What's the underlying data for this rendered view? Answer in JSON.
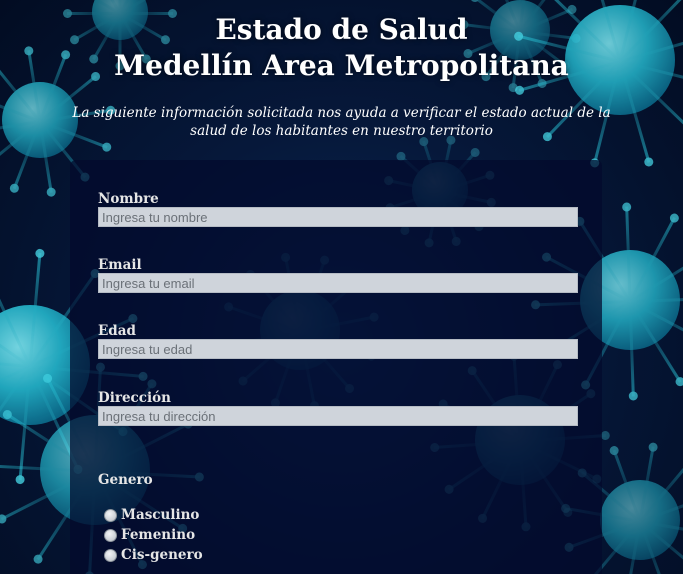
{
  "header": {
    "title_line1": "Estado de Salud",
    "title_line2": "Medellín Area Metropolitana",
    "subtitle": "La siguiente información solicitada nos ayuda a verificar el estado actual de la salud de los habitantes en nuestro territorio"
  },
  "form": {
    "fields": [
      {
        "label": "Nombre",
        "placeholder": "Ingresa tu nombre"
      },
      {
        "label": "Email",
        "placeholder": "Ingresa tu email"
      },
      {
        "label": "Edad",
        "placeholder": "Ingresa tu edad"
      },
      {
        "label": "Dirección",
        "placeholder": "Ingresa tu dirección"
      }
    ],
    "genero": {
      "label": "Genero",
      "options": [
        "Masculino",
        "Femenino",
        "Cis-genero"
      ]
    }
  },
  "theme": {
    "background": "#06183a",
    "virus_color": "#28bed2",
    "input_bg": "#cfd4db"
  }
}
